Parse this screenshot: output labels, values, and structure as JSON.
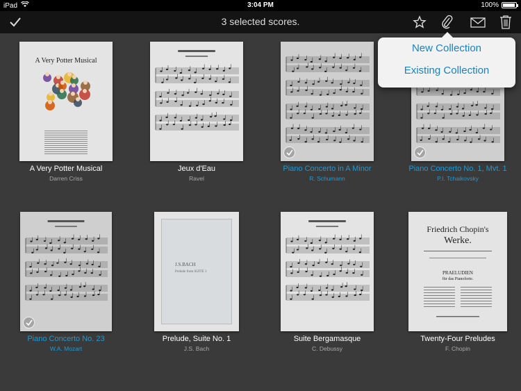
{
  "status_bar": {
    "device": "iPad",
    "time": "3:04 PM",
    "battery": "100%",
    "battery_level": 1.0
  },
  "toolbar": {
    "title": "3 selected scores.",
    "done_icon": "checkmark-icon",
    "icons": [
      "star-icon",
      "paperclip-icon",
      "envelope-icon",
      "trash-icon"
    ]
  },
  "popover": {
    "options": [
      "New Collection",
      "Existing Collection"
    ]
  },
  "scores": [
    {
      "title": "A Very Potter Musical",
      "composer": "Darren Criss",
      "selected": false
    },
    {
      "title": "Jeux d'Eau",
      "composer": "Ravel",
      "selected": false
    },
    {
      "title": "Piano Concerto in A Minor",
      "composer": "R. Schumann",
      "selected": true
    },
    {
      "title": "Piano Concerto No. 1, Mvt. 1",
      "composer": "P.I. Tchaikovsky",
      "selected": true
    },
    {
      "title": "Piano Concerto No. 23",
      "composer": "W.A. Mozart",
      "selected": true
    },
    {
      "title": "Prelude, Suite No. 1",
      "composer": "J.S. Bach",
      "selected": false
    },
    {
      "title": "Suite Bergamasque",
      "composer": "C. Debussy",
      "selected": false
    },
    {
      "title": "Twenty-Four Preludes",
      "composer": "F. Chopin",
      "selected": false
    }
  ],
  "covers": {
    "potter": {
      "heading": "A Very Potter Musical"
    },
    "bach": {
      "line1": "J.S.BACH",
      "line2": "Prelude from SUITE 1"
    },
    "chopin": {
      "line1": "Friedrich Chopin's",
      "line2": "Werke.",
      "line3": "PRAELUDIEN",
      "line4": "für das Pianoforte."
    }
  },
  "colors": {
    "accent": "#1e9ad6",
    "popover_text": "#1a82c4",
    "background": "#3a3a3a",
    "toolbar": "#141414"
  }
}
